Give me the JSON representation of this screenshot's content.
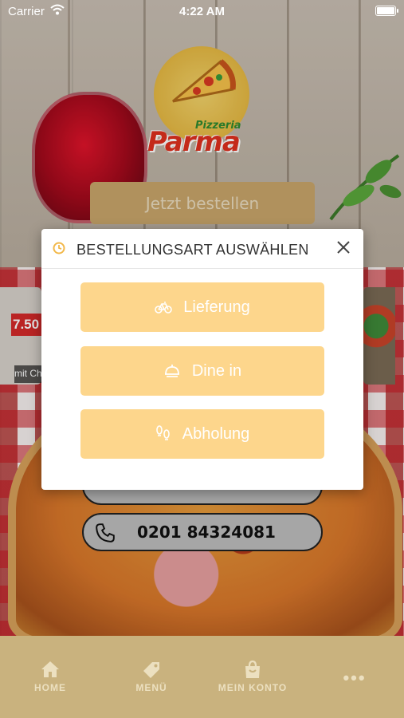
{
  "status_bar": {
    "carrier": "Carrier",
    "time": "4:22 AM"
  },
  "logo": {
    "small": "Pizzeria",
    "big": "Parma"
  },
  "order_button_label": "Jetzt bestellen",
  "side_card": {
    "price": "7.50",
    "caption": "mit Ch"
  },
  "phone": {
    "number": "0201 84324081"
  },
  "modal": {
    "title": "BESTELLUNGSART AUSWÄHLEN",
    "options": [
      {
        "label": "Lieferung",
        "icon": "bicycle-icon"
      },
      {
        "label": "Dine in",
        "icon": "dish-icon"
      },
      {
        "label": "Abholung",
        "icon": "footprints-icon"
      }
    ]
  },
  "tabbar": {
    "items": [
      {
        "label": "HOME",
        "icon": "home-icon"
      },
      {
        "label": "MENÜ",
        "icon": "tag-icon"
      },
      {
        "label": "MEIN KONTO",
        "icon": "bag-icon"
      },
      {
        "label": "•••",
        "icon": "more-icon"
      }
    ]
  },
  "colors": {
    "option_bg": "#fdd68c",
    "tabbar_bg": "#c9b27e",
    "price_red": "#d42a2a"
  }
}
